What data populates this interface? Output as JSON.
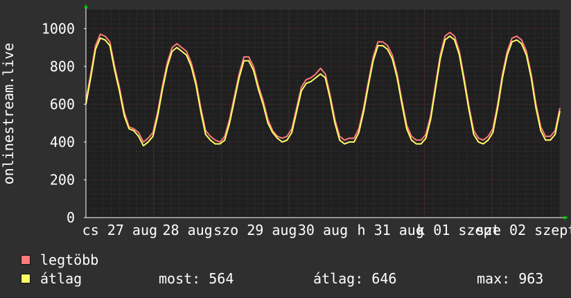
{
  "chart_data": {
    "type": "line",
    "ylabel": "onlinestream.live",
    "ylim": [
      0,
      1100
    ],
    "yticks": [
      0,
      200,
      400,
      600,
      800,
      1000
    ],
    "x_tick_labels": [
      "cs 27 aug",
      "28 aug",
      "szo 29 aug",
      "30 aug",
      "h 31 aug",
      "k 01 szept",
      "sze 02 szept"
    ],
    "grid": true,
    "legend_position": "bottom-left",
    "colors": {
      "background": "#2f2f2f",
      "plot_bg": "#1f1f1f",
      "grid_minor": "#3a3a3a",
      "grid_major": "#5a2f2f",
      "axis": "#ffffff",
      "arrow": "#00cc00",
      "legtobb": "#ff7a7a",
      "atlag": "#ffff66"
    },
    "series": [
      {
        "name": "legtöbb",
        "color": "#ff7a7a",
        "values": [
          620,
          760,
          910,
          970,
          960,
          930,
          800,
          690,
          560,
          480,
          470,
          450,
          400,
          420,
          450,
          560,
          700,
          820,
          900,
          920,
          900,
          880,
          820,
          720,
          580,
          460,
          430,
          410,
          400,
          430,
          520,
          640,
          760,
          850,
          850,
          800,
          700,
          620,
          520,
          460,
          430,
          420,
          430,
          470,
          580,
          690,
          730,
          740,
          760,
          790,
          760,
          650,
          520,
          430,
          410,
          420,
          420,
          470,
          580,
          720,
          850,
          930,
          930,
          910,
          860,
          760,
          620,
          490,
          430,
          410,
          410,
          440,
          540,
          700,
          860,
          960,
          980,
          960,
          880,
          740,
          590,
          460,
          420,
          410,
          430,
          470,
          600,
          760,
          880,
          950,
          960,
          940,
          880,
          760,
          600,
          480,
          430,
          430,
          460,
          580
        ]
      },
      {
        "name": "átlag",
        "color": "#ffff66",
        "values": [
          600,
          740,
          890,
          950,
          940,
          910,
          780,
          670,
          540,
          470,
          460,
          430,
          380,
          400,
          430,
          540,
          680,
          800,
          880,
          900,
          880,
          860,
          800,
          700,
          560,
          440,
          410,
          390,
          390,
          410,
          500,
          620,
          740,
          830,
          830,
          780,
          680,
          600,
          500,
          450,
          420,
          400,
          410,
          450,
          560,
          670,
          710,
          720,
          740,
          760,
          740,
          630,
          500,
          410,
          390,
          400,
          400,
          450,
          560,
          700,
          830,
          910,
          910,
          890,
          840,
          740,
          600,
          470,
          410,
          390,
          390,
          420,
          520,
          680,
          840,
          940,
          960,
          940,
          860,
          720,
          570,
          440,
          400,
          390,
          410,
          450,
          580,
          740,
          860,
          930,
          940,
          920,
          860,
          740,
          580,
          460,
          410,
          410,
          440,
          564
        ]
      }
    ]
  },
  "legend": {
    "items": [
      {
        "label": "legtöbb",
        "color": "#ff7a7a"
      },
      {
        "label": "átlag",
        "color": "#ffff66"
      }
    ],
    "stats": {
      "most": "most: 564",
      "atlag": "átlag: 646",
      "max": "max: 963"
    }
  }
}
